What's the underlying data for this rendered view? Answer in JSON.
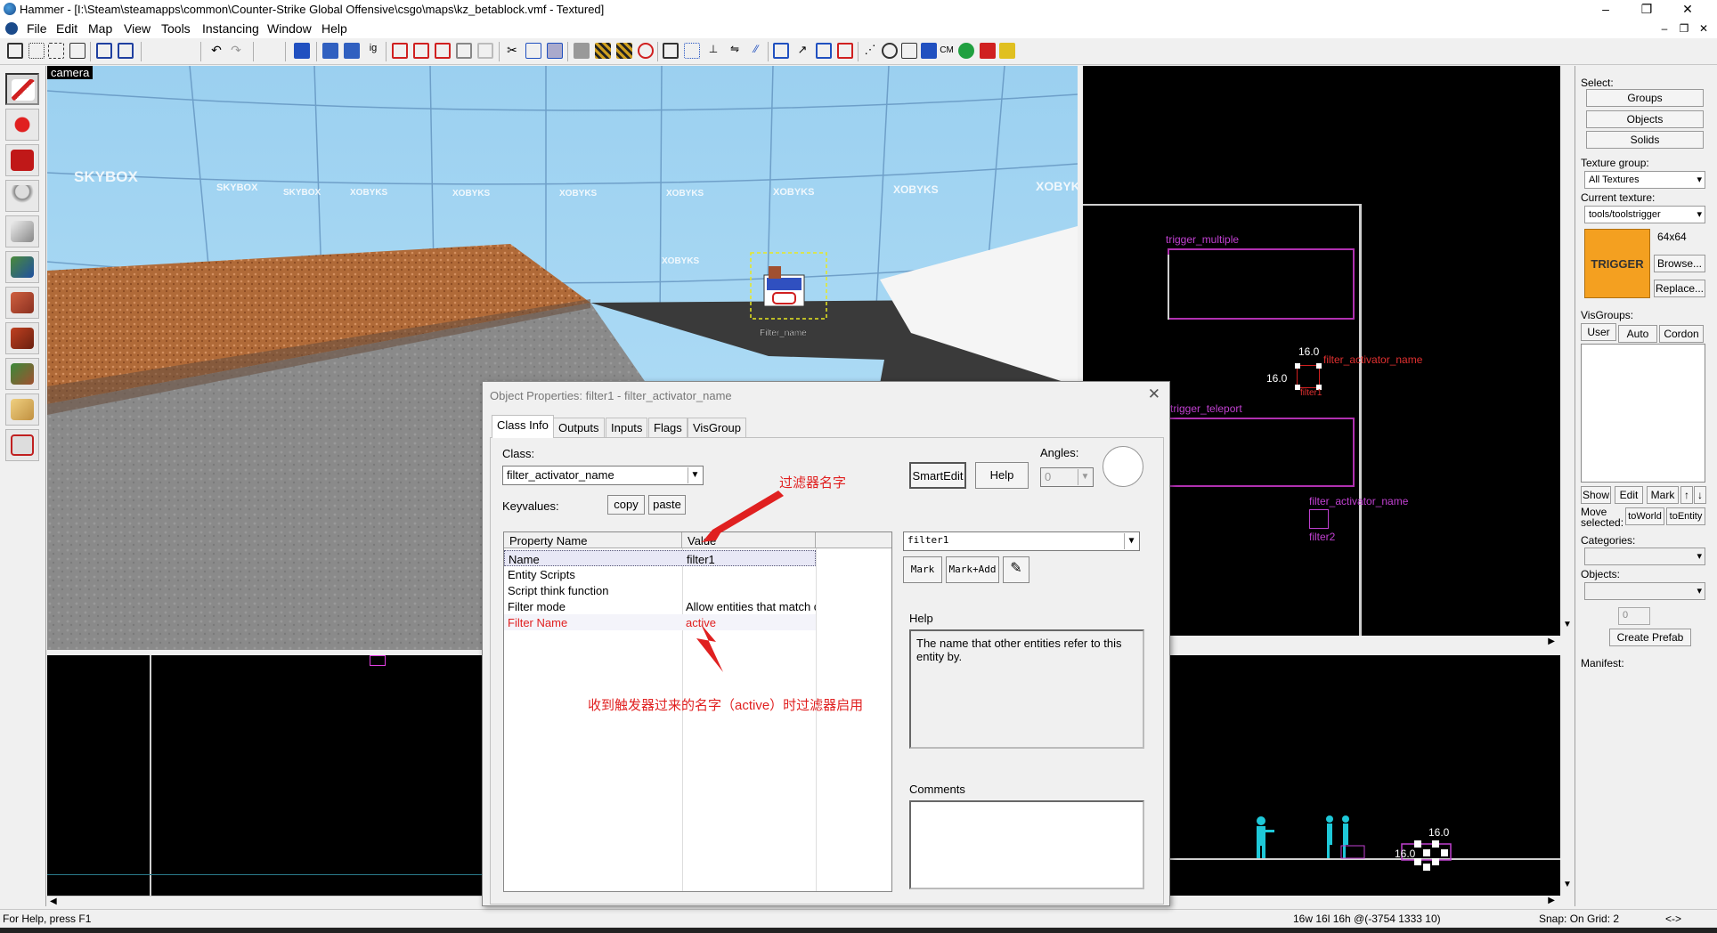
{
  "window": {
    "title": "Hammer - [I:\\Steam\\steamapps\\common\\Counter-Strike Global Offensive\\csgo\\maps\\kz_betablock.vmf - Textured]",
    "min": "–",
    "max": "❐",
    "close": "✕"
  },
  "menu": {
    "items": [
      "File",
      "Edit",
      "Map",
      "View",
      "Tools",
      "Instancing",
      "Window",
      "Help"
    ]
  },
  "view3d": {
    "label": "camera",
    "skybox_texts": [
      "SKYBOX",
      "SKYBOX",
      "SKYBOX",
      "XOBYKS",
      "XOBYKS",
      "XOBYKS",
      "XOBYKS",
      "XOBYKS",
      "XOBYKS",
      "XOBYKS",
      "XOBYKS"
    ],
    "entity_label": "Filter_name"
  },
  "view_top": {
    "labels": {
      "trigger_multiple": "trigger_multiple",
      "dim_h": "16.0",
      "dim_v": "16.0",
      "activator_name": "filter_activator_name",
      "filter_small": "filter1",
      "trigger_teleport": "trigger_teleport",
      "activator_name2": "filter_activator_name",
      "filter2": "filter2"
    }
  },
  "view_side": {
    "dim_h": "16.0",
    "dim_v": "16.0"
  },
  "right_panel": {
    "select_label": "Select:",
    "groups": "Groups",
    "objects": "Objects",
    "solids": "Solids",
    "texture_group_label": "Texture group:",
    "texture_group_value": "All Textures",
    "current_texture_label": "Current texture:",
    "current_texture_value": "tools/toolstrigger",
    "texture_size": "64x64",
    "texture_name": "TRIGGER",
    "browse": "Browse...",
    "replace": "Replace...",
    "visgroups_label": "VisGroups:",
    "tabs": [
      "User",
      "Auto",
      "Cordon"
    ],
    "show": "Show",
    "edit": "Edit",
    "mark": "Mark",
    "up": "↑",
    "down": "↓",
    "move_selected_label": "Move selected:",
    "to_world": "toWorld",
    "to_entity": "toEntity",
    "categories_label": "Categories:",
    "objects_label": "Objects:",
    "count": "0",
    "create_prefab": "Create Prefab",
    "manifest_label": "Manifest:"
  },
  "statusbar": {
    "help": "For Help, press F1",
    "size": "16w 16l 16h @(-3754 1333 10)",
    "snap": "Snap: On Grid: 2",
    "arrows": "<->"
  },
  "dialog": {
    "title": "Object Properties: filter1 - filter_activator_name",
    "tabs": [
      "Class Info",
      "Outputs",
      "Inputs",
      "Flags",
      "VisGroup"
    ],
    "class_label": "Class:",
    "class_value": "filter_activator_name",
    "keyvalues_label": "Keyvalues:",
    "copy": "copy",
    "paste": "paste",
    "smartedit": "SmartEdit",
    "help_btn": "Help",
    "angles_label": "Angles:",
    "angles_value": "0",
    "table_headers": [
      "Property Name",
      "Value"
    ],
    "rows": [
      {
        "key": "Name",
        "value": "filter1"
      },
      {
        "key": "Entity Scripts",
        "value": ""
      },
      {
        "key": "Script think function",
        "value": ""
      },
      {
        "key": "Filter mode",
        "value": "Allow entities that match c"
      },
      {
        "key": "Filter Name",
        "value": "active"
      }
    ],
    "value_select": "filter1",
    "mark": "Mark",
    "mark_add": "Mark+Add",
    "help_label": "Help",
    "help_text": "The name that other entities refer to this entity by.",
    "comments_label": "Comments"
  },
  "annotations": {
    "filter_name": "过滤器名字",
    "explain": "收到触发器过来的名字（active）时过滤器启用"
  }
}
